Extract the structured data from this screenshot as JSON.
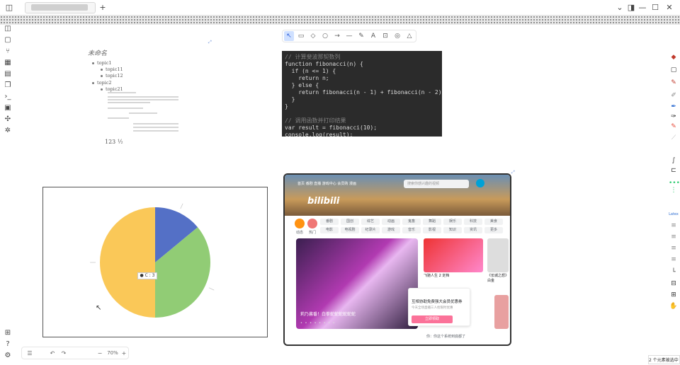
{
  "window": {
    "tab_label": "",
    "new_tab": "+",
    "controls": {
      "dropdown": "⌄",
      "layout": "◨",
      "minimize": "—",
      "maximize": "☐",
      "close": "✕"
    }
  },
  "left_sidebar": {
    "icons": [
      "panel-icon",
      "file-icon",
      "branch-icon",
      "grid-icon",
      "calendar-icon",
      "copy-icon",
      "terminal-icon",
      "layers-icon",
      "puzzle-icon",
      "wand-icon"
    ],
    "bottom_icons": [
      "grid-icon",
      "help-icon",
      "settings-icon"
    ]
  },
  "toolbar": {
    "tools": [
      "↖",
      "▭",
      "◇",
      "○",
      "→",
      "—",
      "✎",
      "A",
      "⊡",
      "◎",
      "△"
    ],
    "active_index": 0
  },
  "mindmap": {
    "title": "未命名",
    "items": [
      {
        "label": "topic1",
        "level": 1
      },
      {
        "label": "topic11",
        "level": 2
      },
      {
        "label": "topic12",
        "level": 2
      },
      {
        "label": "topic2",
        "level": 1
      },
      {
        "label": "topic21",
        "level": 2
      }
    ],
    "fraction_text": "123 ½"
  },
  "code": {
    "lines": [
      {
        "t": "// 计算斐波那契数列",
        "cls": "c"
      },
      {
        "t": "function fibonacci(n) {",
        "cls": ""
      },
      {
        "t": "  if (n <= 1) {",
        "cls": ""
      },
      {
        "t": "    return n;",
        "cls": ""
      },
      {
        "t": "  } else {",
        "cls": ""
      },
      {
        "t": "    return fibonacci(n - 1) + fibonacci(n - 2);",
        "cls": ""
      },
      {
        "t": "  }",
        "cls": ""
      },
      {
        "t": "}",
        "cls": ""
      },
      {
        "t": "",
        "cls": ""
      },
      {
        "t": "// 调用函数并打印结果",
        "cls": "c"
      },
      {
        "t": "var result = fibonacci(10);",
        "cls": ""
      },
      {
        "t": "console.log(result);",
        "cls": ""
      }
    ]
  },
  "chart_data": {
    "type": "pie",
    "slices": [
      {
        "value": 14,
        "color": "#5470c6"
      },
      {
        "value": 36,
        "color": "#91cc75"
      },
      {
        "value": 50,
        "color": "#fac858"
      }
    ],
    "tooltip": "● C : 3"
  },
  "bilibili": {
    "nav_text": "首页 番剧 直播 游戏中心 会员购 漫画",
    "search_placeholder": "搜索你感兴趣的视频",
    "logo": "bilibili",
    "circles": [
      {
        "label": "动态",
        "color": "#ff9212"
      },
      {
        "label": "热门",
        "color": "#f07775"
      }
    ],
    "categories": [
      "番剧",
      "国创",
      "综艺",
      "动画",
      "鬼畜",
      "舞蹈",
      "娱乐",
      "科技",
      "美食",
      "电影",
      "电视剧",
      "纪录片",
      "游戏",
      "音乐",
      "影视",
      "知识",
      "资讯",
      "更多"
    ],
    "banner_caption": "莉乃酱番！白拳蛇蛇蛇蛇蛇蛇",
    "banner_dots": "• • • • • • • •",
    "thumb_titles": [
      "飞驰人生 2 定档",
      "《长城之怒》白金"
    ],
    "popup_title": "互相协助免费强大会员优惠券",
    "popup_sub": "今天全场直播三人抢限时优惠",
    "popup_btn": "立即领取",
    "footer": "你：你这个系统到底都了"
  },
  "right_panel": {
    "label": "Latex"
  },
  "zoom": {
    "value": "70%",
    "minus": "−",
    "plus": "+",
    "undo": "↶",
    "redo": "↷",
    "menu": "☰"
  },
  "status": {
    "text": "2 个元素被选中"
  }
}
